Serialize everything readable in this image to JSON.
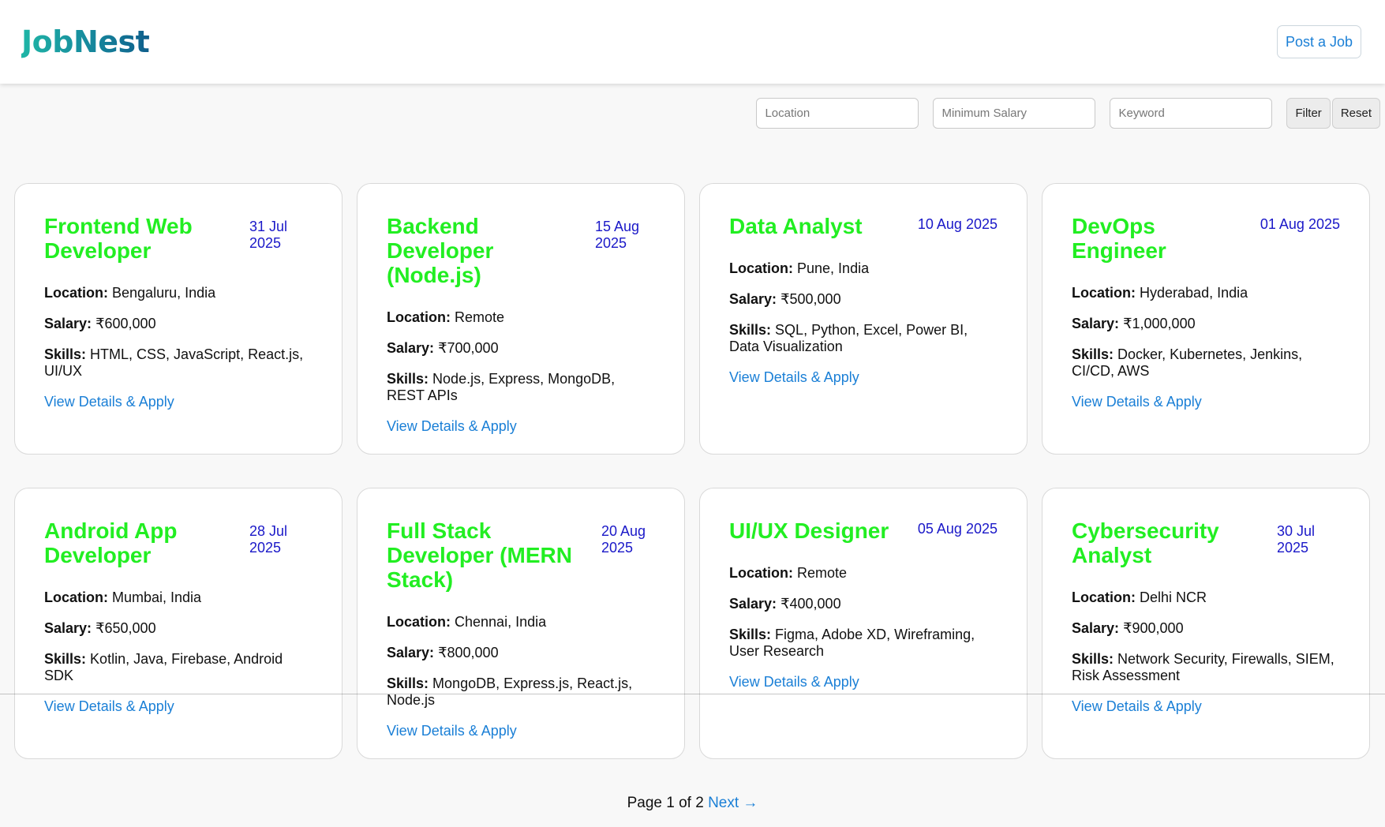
{
  "header": {
    "logo": "JobNest",
    "post_job_label": "Post a Job"
  },
  "filters": {
    "location_placeholder": "Location",
    "salary_placeholder": "Minimum Salary",
    "keyword_placeholder": "Keyword",
    "filter_label": "Filter",
    "reset_label": "Reset"
  },
  "labels": {
    "location": "Location:",
    "salary": "Salary:",
    "skills": "Skills:",
    "apply": "View Details & Apply"
  },
  "jobs": [
    {
      "title": "Frontend Web Developer",
      "date": "31 Jul 2025",
      "location": "Bengaluru, India",
      "salary": "₹600,000",
      "skills": "HTML, CSS, JavaScript, React.js, UI/UX"
    },
    {
      "title": "Backend Developer (Node.js)",
      "date": "15 Aug 2025",
      "location": "Remote",
      "salary": "₹700,000",
      "skills": "Node.js, Express, MongoDB, REST APIs"
    },
    {
      "title": "Data Analyst",
      "date": "10 Aug 2025",
      "location": "Pune, India",
      "salary": "₹500,000",
      "skills": "SQL, Python, Excel, Power BI, Data Visualization"
    },
    {
      "title": "DevOps Engineer",
      "date": "01 Aug 2025",
      "location": "Hyderabad, India",
      "salary": "₹1,000,000",
      "skills": "Docker, Kubernetes, Jenkins, CI/CD, AWS"
    },
    {
      "title": "Android App Developer",
      "date": "28 Jul 2025",
      "location": "Mumbai, India",
      "salary": "₹650,000",
      "skills": "Kotlin, Java, Firebase, Android SDK"
    },
    {
      "title": "Full Stack Developer (MERN Stack)",
      "date": "20 Aug 2025",
      "location": "Chennai, India",
      "salary": "₹800,000",
      "skills": "MongoDB, Express.js, React.js, Node.js"
    },
    {
      "title": "UI/UX Designer",
      "date": "05 Aug 2025",
      "location": "Remote",
      "salary": "₹400,000",
      "skills": "Figma, Adobe XD, Wireframing, User Research"
    },
    {
      "title": "Cybersecurity Analyst",
      "date": "30 Jul 2025",
      "location": "Delhi NCR",
      "salary": "₹900,000",
      "skills": "Network Security, Firewalls, SIEM, Risk Assessment"
    }
  ],
  "pagination": {
    "text": "Page 1 of 2",
    "next_label": "Next →"
  },
  "colors": {
    "title": "#22ee22",
    "date": "#1a18c8",
    "link": "#1a7fd6"
  }
}
